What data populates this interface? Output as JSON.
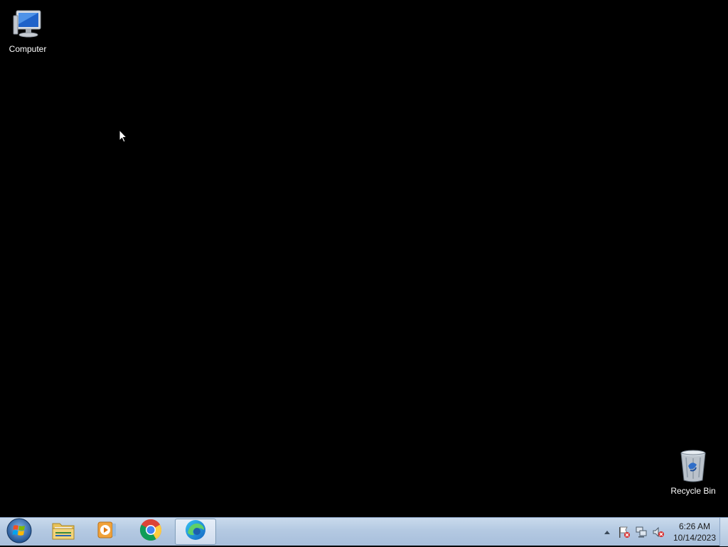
{
  "desktop": {
    "background_color": "#000000",
    "icons": [
      {
        "label": "Computer",
        "icon": "computer-icon"
      },
      {
        "label": "Recycle Bin",
        "icon": "recycle-bin-icon"
      }
    ]
  },
  "taskbar": {
    "start_icon": "windows-start-orb-icon",
    "pinned": [
      {
        "app": "Windows Explorer",
        "icon": "folder-icon"
      },
      {
        "app": "Windows Media Player",
        "icon": "media-player-icon"
      },
      {
        "app": "Google Chrome",
        "icon": "chrome-icon"
      },
      {
        "app": "Microsoft Edge",
        "icon": "edge-icon",
        "active": true
      }
    ],
    "tray": {
      "icons": [
        "show-hidden-icons-arrow-icon",
        "action-center-flag-icon",
        "network-icon",
        "volume-muted-icon"
      ],
      "time": "6:26 AM",
      "date": "10/14/2023"
    }
  }
}
